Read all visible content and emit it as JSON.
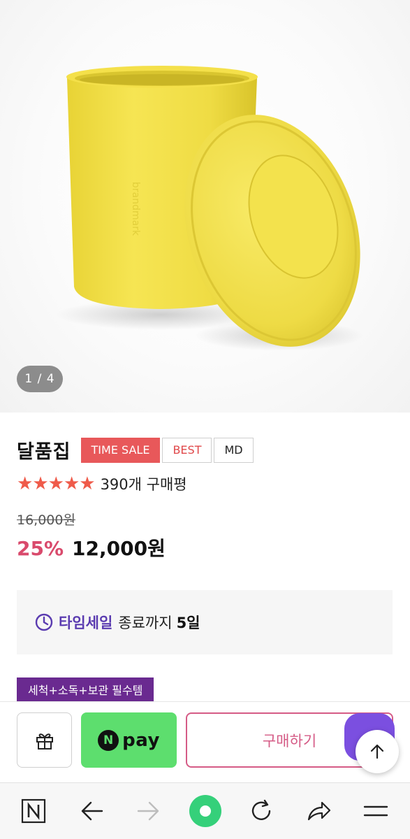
{
  "gallery": {
    "pager_text": "1 / 4",
    "product_color": "#f1e14a"
  },
  "product": {
    "name": "달품집",
    "badges": [
      "TIME SALE",
      "BEST",
      "MD"
    ],
    "rating_stars": 5,
    "review_text": "390개 구매평",
    "original_price": "16,000원",
    "discount": "25%",
    "price": "12,000원"
  },
  "timesale": {
    "label": "타임세일",
    "text": "종료까지",
    "days": "5일",
    "icon": "clock-icon"
  },
  "tag": "세척+소독+보관 필수템",
  "buybar": {
    "gift_icon": "gift-icon",
    "npay_logo": "N",
    "npay_text": "pay",
    "buy_label": "구매하기"
  },
  "browser_nav": {
    "items": [
      "naver-home-icon",
      "back-arrow-icon",
      "forward-arrow-icon",
      "naver-green-dot-icon",
      "reload-icon",
      "share-icon",
      "menu-icon"
    ]
  },
  "colors": {
    "sale_badge": "#e8585a",
    "discount": "#d94a6c",
    "star": "#ef5b4a",
    "timesale_label": "#5a3bb0",
    "tag_bg": "#6a2a90",
    "npay_green": "#5dde6e",
    "buy_border": "#d55b86"
  }
}
